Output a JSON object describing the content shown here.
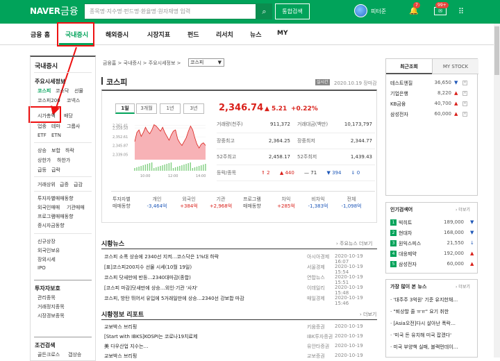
{
  "header": {
    "logo": "NAVER",
    "logo_suffix": "금융",
    "search_placeholder": "종목명·지수명·펀드명·환율명·원자재명 입력",
    "search_button": "통합검색",
    "user_name": "피터준",
    "bell_count": "7",
    "mail_count": "99+",
    "mail_label": "✉"
  },
  "nav": {
    "items": [
      "금융 홈",
      "국내증시",
      "해외증시",
      "시장지표",
      "펀드",
      "리서치",
      "뉴스",
      "MY"
    ]
  },
  "left": {
    "title": "국내증시",
    "section_market": "주요시세정보",
    "links_row1": [
      "코스피",
      "코스닥",
      "선물"
    ],
    "link_kospi200": "코스피200",
    "link_kopax": "코넥스",
    "link_sise": "시가총액",
    "link_baedang": "배당",
    "links_row4": [
      "업종",
      "테마",
      "그룹사"
    ],
    "links_row5": [
      "ETF",
      "ETN"
    ],
    "links_row6": [
      "상승",
      "보합",
      "하락"
    ],
    "links_row7": [
      "상한가",
      "하한가"
    ],
    "links_row8": [
      "급등",
      "급락"
    ],
    "links_row9": [
      "거래상위",
      "급증",
      "급감"
    ],
    "invest_items": [
      "투자자별매매동향",
      "외국인매매",
      "기관매매",
      "프로그램매매동향",
      "증시자금동향"
    ],
    "misc": [
      "신규상장",
      "외국인보유",
      "장외시세",
      "IPO"
    ],
    "section_invest": "투자자보호",
    "protect": [
      "관리종목",
      "거래정지종목",
      "시장경보종목"
    ],
    "section_cond": "조건검색",
    "cond_items": [
      "골든크로스",
      "갭상승"
    ]
  },
  "breadcrumb": {
    "items": [
      "금융홈",
      "국내증시",
      "주요시세정보"
    ],
    "select": "코스피"
  },
  "page": {
    "title": "코스피",
    "badge": "실시간",
    "date": "2020.10.19 장마감"
  },
  "chart_tabs": [
    "1일",
    "3개월",
    "1년",
    "3년"
  ],
  "index": {
    "value": "2,346.74",
    "change": "▲ 5.21",
    "rate": "+0.22%"
  },
  "stats": {
    "row1": {
      "k1": "거래량(천주)",
      "v1": "911,372",
      "k2": "거래대금(백만)",
      "v2": "10,173,797"
    },
    "row2": {
      "k1": "장중최고",
      "v1": "2,364.25",
      "k2": "장중최저",
      "v2": "2,344.77"
    },
    "row3": {
      "k1": "52주최고",
      "v1": "2,458.17",
      "k2": "52주최저",
      "v2": "1,439.43"
    },
    "row4": {
      "k1": "등락/종목",
      "up_limit": "2",
      "up": "440",
      "flat": "71",
      "down": "394",
      "down_limit": "0"
    }
  },
  "investors": {
    "label1": "투자자별",
    "label2": "매매동향",
    "cols": [
      {
        "k": "개인",
        "v": "-3,464억"
      },
      {
        "k": "외국인",
        "v": "+384억"
      },
      {
        "k": "기관",
        "v": "+2,968억"
      }
    ],
    "plabel1": "프로그램",
    "plabel2": "매매동향",
    "pcols": [
      {
        "k": "차익",
        "v": "+285억"
      },
      {
        "k": "비차익",
        "v": "-1,383억"
      },
      {
        "k": "전체",
        "v": "-1,098억"
      }
    ]
  },
  "news": {
    "title": "시황뉴스",
    "more": "› 주요뉴스 더보기",
    "items": [
      {
        "t": "코스피 소폭 상승에 2340선 지켜…코스닥은 1%대 하락",
        "s": "아시아경제",
        "d": "2020-10-19 16:07"
      },
      {
        "t": "[표]코스피200지수 선물 시세(10월 19일)",
        "s": "서울경제",
        "d": "2020-10-19 15:54"
      },
      {
        "t": "코스피 닷새만에 반등…2340대마감(종합)",
        "s": "연합뉴스",
        "d": "2020-10-19 15:51"
      },
      {
        "t": "[코스피 마감]닷새만에 상승…외인·기관 '사자'",
        "s": "이데일리",
        "d": "2020-10-19 15:48"
      },
      {
        "t": "코스피, 방탄 뛰어서 유입에 5거래일만에 상승…2340선 강보합 마감",
        "s": "매일경제",
        "d": "2020-10-19 15:46"
      }
    ]
  },
  "reports": {
    "title": "시황정보 리포트",
    "more": "› 더보기",
    "items": [
      {
        "t": "교보박스 브리핑",
        "s": "키움증권",
        "d": "2020-10-19"
      },
      {
        "t": "[Start with IBKS]KOSPI는 코로나19치료제",
        "s": "IBK투자증권",
        "d": "2020-10-19"
      },
      {
        "t": "美 다우산업 지수는…",
        "s": "유안타증권",
        "d": "2020-10-19"
      },
      {
        "t": "교보박스 브리핑",
        "s": "교보증권",
        "d": "2020-10-19"
      }
    ]
  },
  "right_recent": {
    "tab1": "최근조회",
    "tab2": "MY STOCK",
    "items": [
      {
        "n": "테스트엔질",
        "v": "36,650",
        "a": "▼"
      },
      {
        "n": "기업은행",
        "v": "8,220",
        "a": "▲"
      },
      {
        "n": "KB금융",
        "v": "40,700",
        "a": "▲"
      },
      {
        "n": "삼성전자",
        "v": "60,000",
        "a": "▲"
      }
    ]
  },
  "right_popular": {
    "title": "인기검색어",
    "more": "› 더보기",
    "items": [
      {
        "r": "1",
        "n": "빅히트",
        "v": "189,000",
        "a": "▼"
      },
      {
        "r": "2",
        "n": "현대차",
        "v": "168,000",
        "a": "▼"
      },
      {
        "r": "3",
        "n": "원익스피스",
        "v": "21,550",
        "a": "↓"
      },
      {
        "r": "4",
        "n": "대응제약",
        "v": "192,000",
        "a": "▲"
      },
      {
        "r": "5",
        "n": "삼성전자",
        "v": "60,000",
        "a": "▲"
      }
    ]
  },
  "right_news": {
    "title": "가장 많이 본 뉴스",
    "more": "› 더보기",
    "items": [
      "· '대주주 3억원' 기준 유지한채…",
      "· \"퇴상할 줄 ㅠㅠ\" 요기 취한",
      "· [Asia오전]다시 살아난 폭락…",
      "· '미국 돈 유치해 미국 잡겠다'",
      "· 미국 부양책 실패, 블랙먼데이…"
    ]
  },
  "chart_data": {
    "type": "line",
    "title": "",
    "xlabel": "",
    "ylabel": "",
    "x_ticks": [
      "10:00",
      "12:00",
      "14:00"
    ],
    "y_ticks": [
      "2,361.41",
      "2,359.50",
      "2,352.61",
      "2,345.87",
      "2,339.05"
    ],
    "ylim": [
      2335,
      2365
    ],
    "values": [
      2349,
      2356,
      2358,
      2353,
      2356,
      2360,
      2357,
      2355,
      2358,
      2362,
      2361,
      2359,
      2357,
      2360,
      2356,
      2353,
      2350,
      2354,
      2357,
      2358,
      2351,
      2348,
      2346,
      2349,
      2352,
      2357,
      2361,
      2358,
      2352,
      2347,
      2344,
      2347,
      2348,
      2346
    ]
  }
}
